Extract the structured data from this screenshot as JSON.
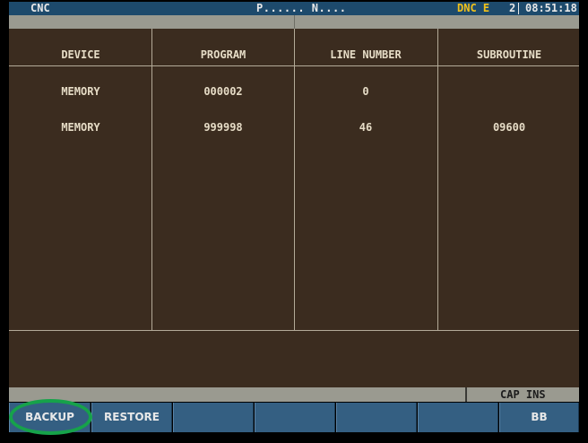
{
  "title_bar": {
    "app_name": "CNC",
    "program_sequence": "P...... N....",
    "mode": "DNC E",
    "mode_number": "2",
    "clock": "08:51:18"
  },
  "table": {
    "headers": [
      "DEVICE",
      "PROGRAM",
      "LINE NUMBER",
      "SUBROUTINE"
    ],
    "rows": [
      [
        "MEMORY",
        "000002",
        "0",
        ""
      ],
      [
        "MEMORY",
        "999998",
        "46",
        "09600"
      ]
    ]
  },
  "status_bar": {
    "input_mode": "CAP INS"
  },
  "softkeys": {
    "backup_label": "BACKUP",
    "restore_label": "RESTORE",
    "blank_3": "",
    "blank_4": "",
    "blank_5": "",
    "blank_6": "",
    "bb_label": "BB"
  },
  "colors": {
    "title_bg": "#1d4a6c",
    "mode_text": "#f2c21a",
    "panel_bg": "#3b2c1f",
    "softkey_bg": "#345f82",
    "highlight_ring": "#16a24a"
  }
}
